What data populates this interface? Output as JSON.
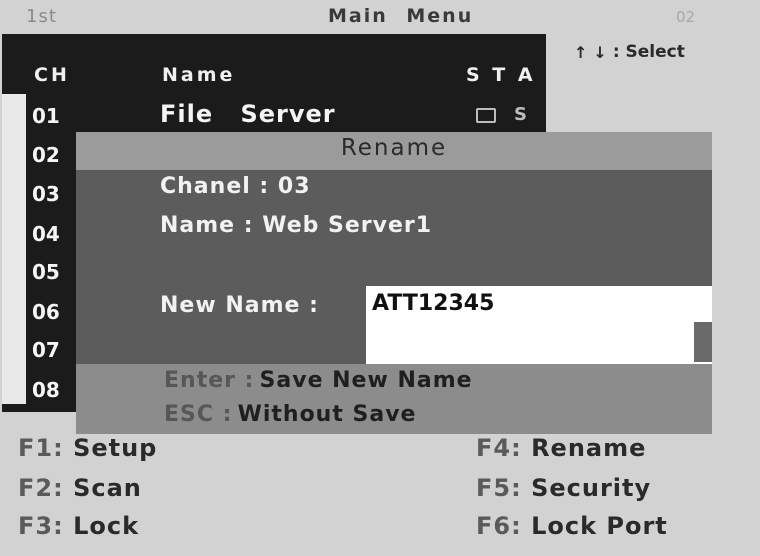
{
  "header": {
    "left": "1st",
    "center": "Main  Menu",
    "right": "02"
  },
  "select_hint": {
    "up": "↑",
    "down": "↓",
    "text": ": Select"
  },
  "list": {
    "columns": [
      "CH",
      "Name",
      "S T A"
    ],
    "rows": [
      {
        "ch": "01",
        "name": "File  Server",
        "status": "S"
      },
      {
        "ch": "02"
      },
      {
        "ch": "03"
      },
      {
        "ch": "04"
      },
      {
        "ch": "05"
      },
      {
        "ch": "06"
      },
      {
        "ch": "07"
      },
      {
        "ch": "08"
      }
    ]
  },
  "dialog": {
    "title": "Rename",
    "channel_line": "Chanel : 03",
    "name_line": "Name : Web Server1",
    "new_name_label": "New Name :",
    "new_name_value": "ATT12345",
    "enter_key": "Enter :",
    "enter_desc": "Save New Name",
    "esc_key": "ESC :",
    "esc_desc": "Without Save"
  },
  "fkeys": [
    {
      "key": "F1:",
      "label": "Setup"
    },
    {
      "key": "F2:",
      "label": "Scan"
    },
    {
      "key": "F3:",
      "label": "Lock"
    },
    {
      "key": "F4:",
      "label": "Rename"
    },
    {
      "key": "F5:",
      "label": "Security"
    },
    {
      "key": "F6:",
      "label": "Lock  Port"
    }
  ]
}
